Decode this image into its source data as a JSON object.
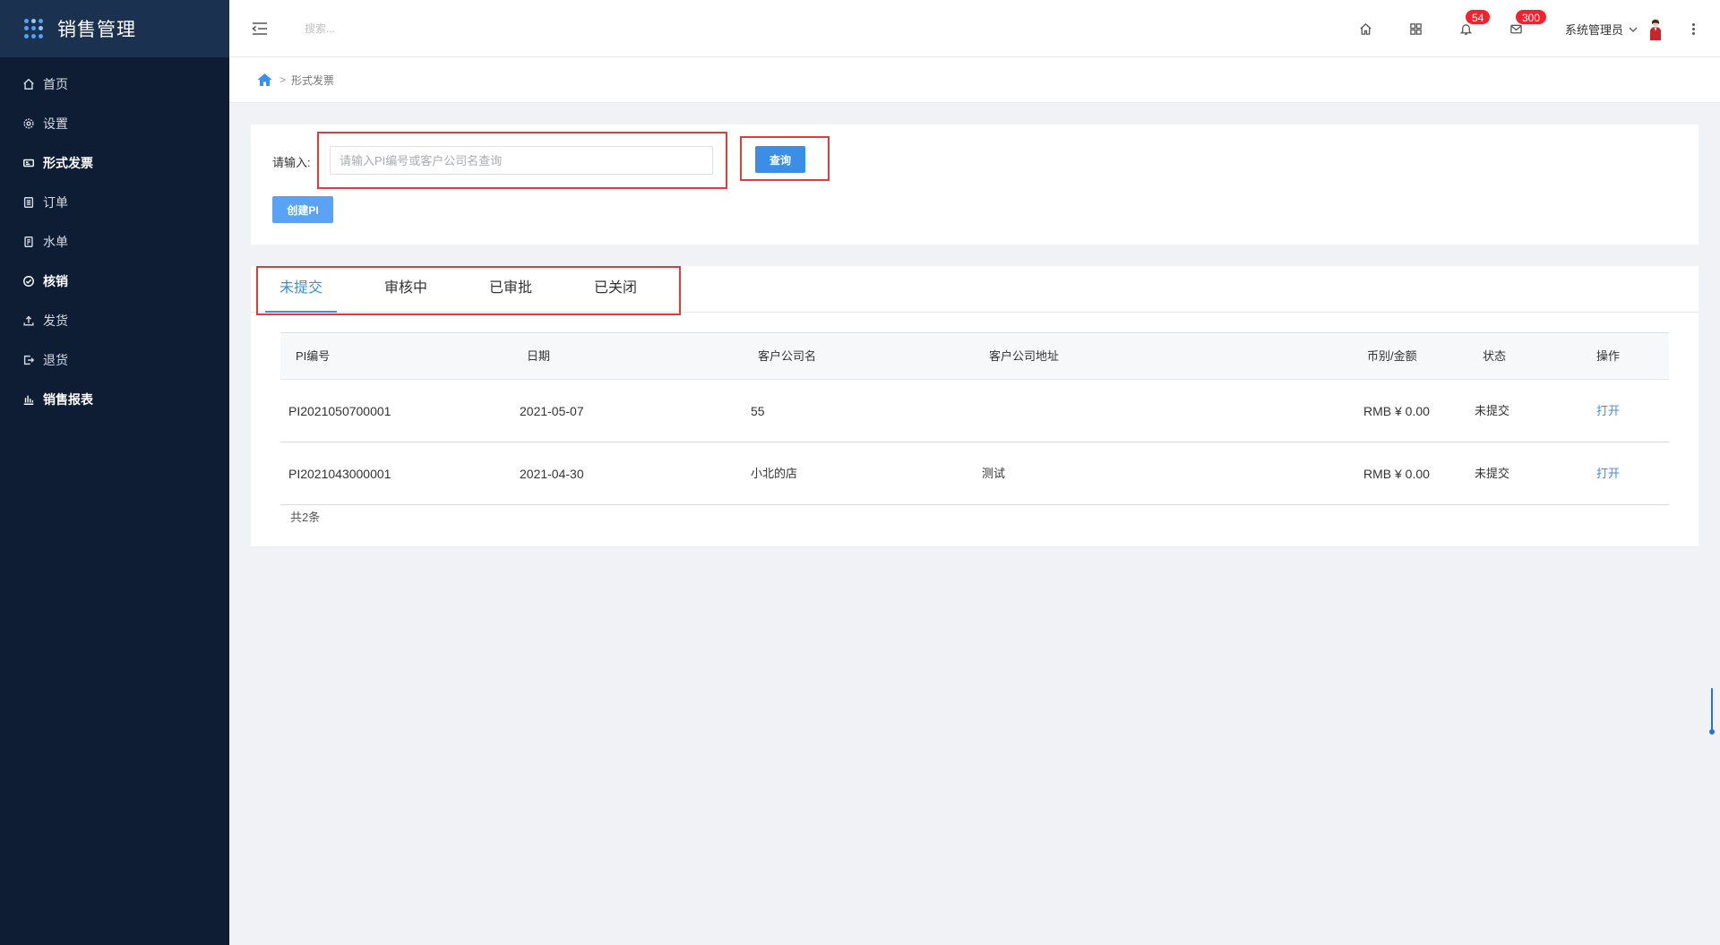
{
  "sidebar": {
    "brand": "销售管理",
    "items": [
      {
        "label": "首页",
        "icon": "home-icon"
      },
      {
        "label": "设置",
        "icon": "gear-icon"
      },
      {
        "label": "形式发票",
        "icon": "invoice-icon",
        "active": true
      },
      {
        "label": "订单",
        "icon": "order-icon"
      },
      {
        "label": "水单",
        "icon": "receipt-icon"
      },
      {
        "label": "核销",
        "icon": "check-circle-icon"
      },
      {
        "label": "发货",
        "icon": "upload-icon"
      },
      {
        "label": "退货",
        "icon": "logout-icon"
      },
      {
        "label": "销售报表",
        "icon": "bar-chart-icon"
      }
    ]
  },
  "header": {
    "search_placeholder": "搜索...",
    "notifications_count": "54",
    "messages_count": "300",
    "user_name": "系统管理员"
  },
  "breadcrumb": {
    "current": "形式发票",
    "separator": ">"
  },
  "search": {
    "label": "请输入:",
    "placeholder": "请输入PI编号或客户公司名查询",
    "value": "",
    "query_button": "查询",
    "create_button": "创建PI"
  },
  "tabs": [
    {
      "label": "未提交",
      "active": true
    },
    {
      "label": "审核中"
    },
    {
      "label": "已审批"
    },
    {
      "label": "已关闭"
    }
  ],
  "table": {
    "columns": [
      "PI编号",
      "日期",
      "客户公司名",
      "客户公司地址",
      "币别/金额",
      "状态",
      "操作"
    ],
    "rows": [
      {
        "pi_no": "PI2021050700001",
        "date": "2021-05-07",
        "company": "55",
        "address": "",
        "amount": "RMB ¥ 0.00",
        "status": "未提交",
        "action": "打开"
      },
      {
        "pi_no": "PI2021043000001",
        "date": "2021-04-30",
        "company": "小北的店",
        "address": "测试",
        "amount": "RMB ¥ 0.00",
        "status": "未提交",
        "action": "打开"
      }
    ],
    "total": "共2条"
  },
  "colors": {
    "sidebar_bg": "#0e1d33",
    "brand_bg": "#1a3150",
    "primary": "#3a8ee6",
    "badge": "#f5222d",
    "highlight": "#e23b3b"
  }
}
